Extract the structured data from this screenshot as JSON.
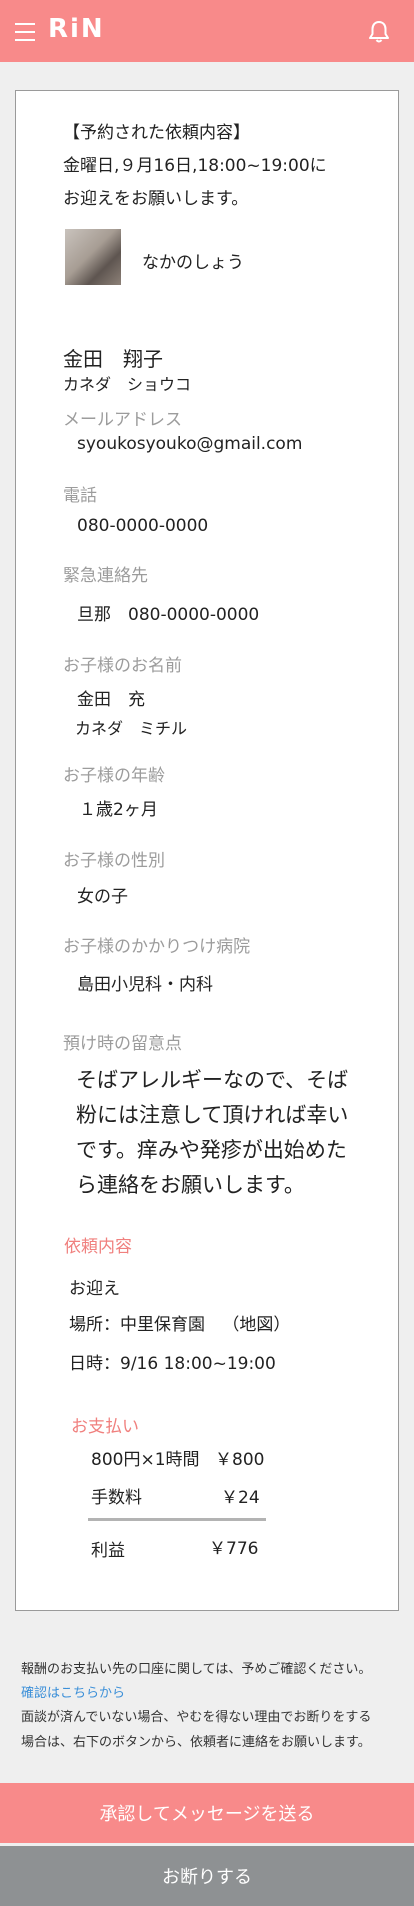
{
  "header": {
    "logo": "RiN",
    "menu_icon": "hamburger-menu-icon",
    "bell_icon": "bell-icon"
  },
  "request": {
    "heading": "【予約された依頼内容】",
    "line1": "金曜日,９月16日,18:00~19:00に",
    "line2": "お迎えをお願いします。",
    "sitter_name": "なかのしょう"
  },
  "parent": {
    "name": "金田　翔子",
    "kana": "カネダ　ショウコ",
    "email_label": "メールアドレス",
    "email": "syoukosyouko@gmail.com",
    "phone_label": "電話",
    "phone": "080-0000-0000",
    "emergency_label": "緊急連絡先",
    "emergency": "旦那　080-0000-0000"
  },
  "child": {
    "name_label": "お子様のお名前",
    "name": "金田　充",
    "kana": "カネダ　ミチル",
    "age_label": "お子様の年齢",
    "age": "１歳2ヶ月",
    "gender_label": "お子様の性別",
    "gender": "女の子",
    "hospital_label": "お子様のかかりつけ病院",
    "hospital": "島田小児科・内科",
    "note_label": "預け時の留意点",
    "note": "そばアレルギーなので、そば粉には注意して頂ければ幸いです。痒みや発疹が出始めたら連絡をお願いします。"
  },
  "details": {
    "label": "依頼内容",
    "type": "お迎え",
    "place_prefix": "場所：中里保育園",
    "map_link": "（地図）",
    "datetime": "日時：9/16 18:00~19:00"
  },
  "payment": {
    "label": "お支払い",
    "rate_label": "800円×1時間",
    "rate_value": "￥800",
    "fee_label": "手数料",
    "fee_value": "￥24",
    "profit_label": "利益",
    "profit_value": "￥776"
  },
  "footer": {
    "line1": "報酬のお支払い先の口座に関しては、予めご確認ください。",
    "link": "確認はこちらから",
    "line2": "面談が済んでいない場合、やむを得ない理由でお断りをする",
    "line3": "場合は、右下のボタンから、依頼者に連絡をお願いします。"
  },
  "buttons": {
    "approve": "承認してメッセージを送る",
    "decline": "お断りする"
  },
  "colors": {
    "accent": "#f88a8a",
    "decline": "#8e9193",
    "link": "#3b8fd8",
    "label": "#9c9c9c"
  }
}
